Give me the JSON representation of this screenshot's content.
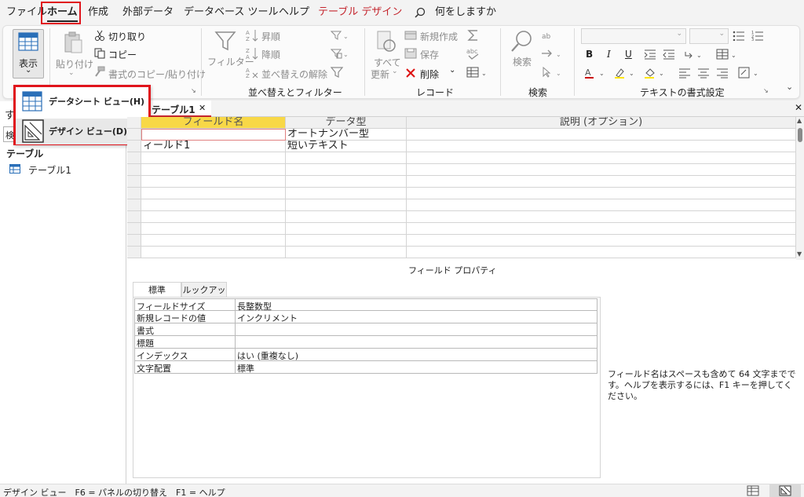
{
  "menu": {
    "tabs": [
      "ファイル",
      "ホーム",
      "作成",
      "外部データ",
      "データベース ツール",
      "ヘルプ",
      "テーブル デザイン"
    ],
    "tell_me": "何をしますか"
  },
  "ribbon": {
    "view": {
      "label": "表示",
      "arrow": "⌄"
    },
    "clipboard": {
      "paste": "貼り付け",
      "cut": "切り取り",
      "copy": "コピー",
      "format_painter": "書式のコピー/貼り付け"
    },
    "sort_filter": {
      "filter": "フィルター",
      "ascending": "昇順",
      "descending": "降順",
      "remove_sort": "並べ替えの解除",
      "group": "並べ替えとフィルター"
    },
    "records": {
      "refresh_line1": "すべて",
      "refresh_line2": "更新",
      "new": "新規作成",
      "save": "保存",
      "delete": "削除",
      "group": "レコード"
    },
    "find": {
      "find": "検索",
      "group": "検索"
    },
    "text_format": {
      "bold": "B",
      "italic": "I",
      "underline": "U",
      "group": "テキストの書式設定"
    }
  },
  "view_dropdown": {
    "datasheet": "データシート ビュー(H)",
    "design": "デザイン ビュー(D)"
  },
  "nav": {
    "title": "す",
    "search": "検",
    "section": "テーブル",
    "item": "テーブル1"
  },
  "document_tab": {
    "label": "テーブル1",
    "close": "✕"
  },
  "grid": {
    "headers": [
      "フィールド名",
      "データ型",
      "説明 (オプション)"
    ],
    "rows": [
      {
        "field": "",
        "type": "オートナンバー型"
      },
      {
        "field": "ィールド1",
        "type": "短いテキスト"
      }
    ]
  },
  "field_properties": {
    "title": "フィールド プロパティ",
    "tabs": [
      "標準",
      "ルックアップ"
    ],
    "rows": [
      {
        "name": "フィールドサイズ",
        "value": "長整数型"
      },
      {
        "name": "新規レコードの値",
        "value": "インクリメント"
      },
      {
        "name": "書式",
        "value": ""
      },
      {
        "name": "標題",
        "value": ""
      },
      {
        "name": "インデックス",
        "value": "はい (重複なし)"
      },
      {
        "name": "文字配置",
        "value": "標準"
      }
    ],
    "help": "フィールド名はスペースも含めて 64 文字までです。ヘルプを表示するには、F1 キーを押してください。"
  },
  "status": {
    "text": "デザイン ビュー　F6 = パネルの切り替え　F1 = ヘルプ"
  },
  "colors": {
    "accent_red": "#c4262e",
    "highlight_red": "#e0141c",
    "field_header_yellow": "#f8d847"
  }
}
